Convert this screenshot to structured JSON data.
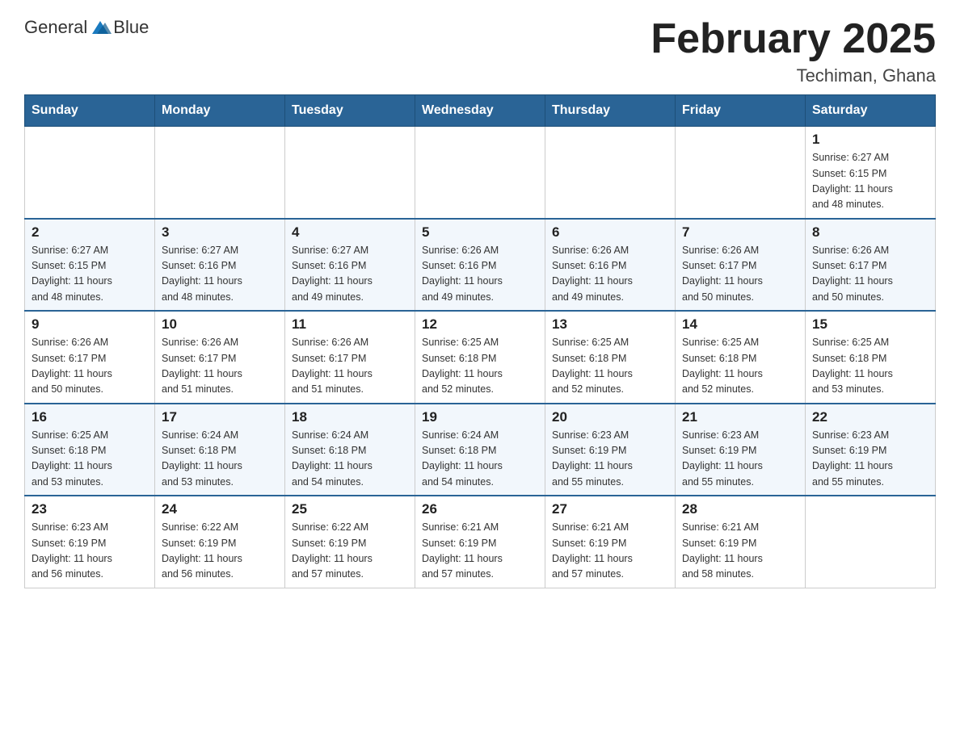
{
  "header": {
    "logo_general": "General",
    "logo_blue": "Blue",
    "month_title": "February 2025",
    "location": "Techiman, Ghana"
  },
  "days_of_week": [
    "Sunday",
    "Monday",
    "Tuesday",
    "Wednesday",
    "Thursday",
    "Friday",
    "Saturday"
  ],
  "weeks": [
    [
      {
        "day": "",
        "info": ""
      },
      {
        "day": "",
        "info": ""
      },
      {
        "day": "",
        "info": ""
      },
      {
        "day": "",
        "info": ""
      },
      {
        "day": "",
        "info": ""
      },
      {
        "day": "",
        "info": ""
      },
      {
        "day": "1",
        "info": "Sunrise: 6:27 AM\nSunset: 6:15 PM\nDaylight: 11 hours\nand 48 minutes."
      }
    ],
    [
      {
        "day": "2",
        "info": "Sunrise: 6:27 AM\nSunset: 6:15 PM\nDaylight: 11 hours\nand 48 minutes."
      },
      {
        "day": "3",
        "info": "Sunrise: 6:27 AM\nSunset: 6:16 PM\nDaylight: 11 hours\nand 48 minutes."
      },
      {
        "day": "4",
        "info": "Sunrise: 6:27 AM\nSunset: 6:16 PM\nDaylight: 11 hours\nand 49 minutes."
      },
      {
        "day": "5",
        "info": "Sunrise: 6:26 AM\nSunset: 6:16 PM\nDaylight: 11 hours\nand 49 minutes."
      },
      {
        "day": "6",
        "info": "Sunrise: 6:26 AM\nSunset: 6:16 PM\nDaylight: 11 hours\nand 49 minutes."
      },
      {
        "day": "7",
        "info": "Sunrise: 6:26 AM\nSunset: 6:17 PM\nDaylight: 11 hours\nand 50 minutes."
      },
      {
        "day": "8",
        "info": "Sunrise: 6:26 AM\nSunset: 6:17 PM\nDaylight: 11 hours\nand 50 minutes."
      }
    ],
    [
      {
        "day": "9",
        "info": "Sunrise: 6:26 AM\nSunset: 6:17 PM\nDaylight: 11 hours\nand 50 minutes."
      },
      {
        "day": "10",
        "info": "Sunrise: 6:26 AM\nSunset: 6:17 PM\nDaylight: 11 hours\nand 51 minutes."
      },
      {
        "day": "11",
        "info": "Sunrise: 6:26 AM\nSunset: 6:17 PM\nDaylight: 11 hours\nand 51 minutes."
      },
      {
        "day": "12",
        "info": "Sunrise: 6:25 AM\nSunset: 6:18 PM\nDaylight: 11 hours\nand 52 minutes."
      },
      {
        "day": "13",
        "info": "Sunrise: 6:25 AM\nSunset: 6:18 PM\nDaylight: 11 hours\nand 52 minutes."
      },
      {
        "day": "14",
        "info": "Sunrise: 6:25 AM\nSunset: 6:18 PM\nDaylight: 11 hours\nand 52 minutes."
      },
      {
        "day": "15",
        "info": "Sunrise: 6:25 AM\nSunset: 6:18 PM\nDaylight: 11 hours\nand 53 minutes."
      }
    ],
    [
      {
        "day": "16",
        "info": "Sunrise: 6:25 AM\nSunset: 6:18 PM\nDaylight: 11 hours\nand 53 minutes."
      },
      {
        "day": "17",
        "info": "Sunrise: 6:24 AM\nSunset: 6:18 PM\nDaylight: 11 hours\nand 53 minutes."
      },
      {
        "day": "18",
        "info": "Sunrise: 6:24 AM\nSunset: 6:18 PM\nDaylight: 11 hours\nand 54 minutes."
      },
      {
        "day": "19",
        "info": "Sunrise: 6:24 AM\nSunset: 6:18 PM\nDaylight: 11 hours\nand 54 minutes."
      },
      {
        "day": "20",
        "info": "Sunrise: 6:23 AM\nSunset: 6:19 PM\nDaylight: 11 hours\nand 55 minutes."
      },
      {
        "day": "21",
        "info": "Sunrise: 6:23 AM\nSunset: 6:19 PM\nDaylight: 11 hours\nand 55 minutes."
      },
      {
        "day": "22",
        "info": "Sunrise: 6:23 AM\nSunset: 6:19 PM\nDaylight: 11 hours\nand 55 minutes."
      }
    ],
    [
      {
        "day": "23",
        "info": "Sunrise: 6:23 AM\nSunset: 6:19 PM\nDaylight: 11 hours\nand 56 minutes."
      },
      {
        "day": "24",
        "info": "Sunrise: 6:22 AM\nSunset: 6:19 PM\nDaylight: 11 hours\nand 56 minutes."
      },
      {
        "day": "25",
        "info": "Sunrise: 6:22 AM\nSunset: 6:19 PM\nDaylight: 11 hours\nand 57 minutes."
      },
      {
        "day": "26",
        "info": "Sunrise: 6:21 AM\nSunset: 6:19 PM\nDaylight: 11 hours\nand 57 minutes."
      },
      {
        "day": "27",
        "info": "Sunrise: 6:21 AM\nSunset: 6:19 PM\nDaylight: 11 hours\nand 57 minutes."
      },
      {
        "day": "28",
        "info": "Sunrise: 6:21 AM\nSunset: 6:19 PM\nDaylight: 11 hours\nand 58 minutes."
      },
      {
        "day": "",
        "info": ""
      }
    ]
  ]
}
